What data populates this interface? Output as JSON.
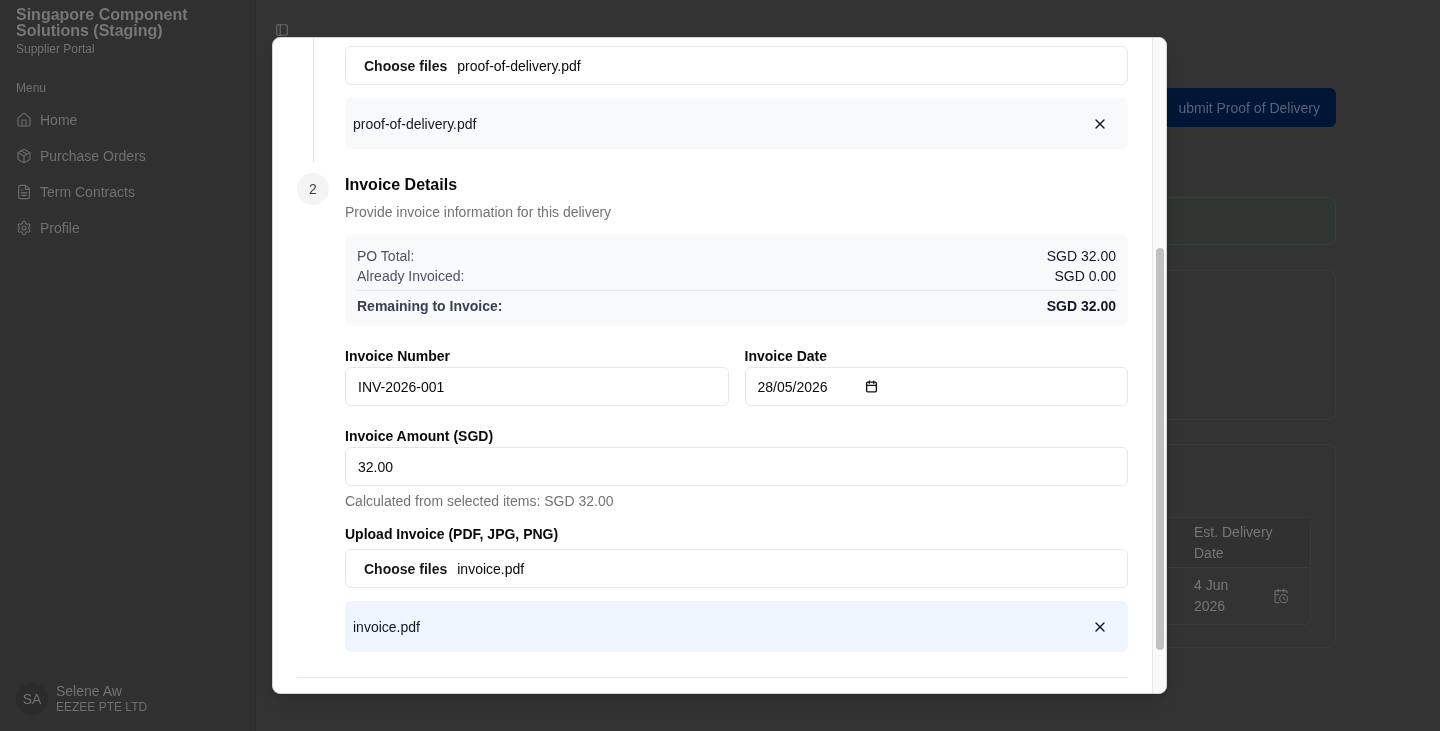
{
  "sidebar": {
    "org_name": "Singapore Component Solutions (Staging)",
    "portal_name": "Supplier Portal",
    "section_heading": "Menu",
    "items": [
      {
        "label": "Home",
        "selected": false
      },
      {
        "label": "Purchase Orders",
        "selected": false
      },
      {
        "label": "Term Contracts",
        "selected": false
      },
      {
        "label": "Profile",
        "selected": false
      }
    ],
    "user": {
      "initials": "SA",
      "name": "Selene Aw",
      "company": "EEZEE PTE LTD"
    }
  },
  "page": {
    "primary_button": "ubmit Proof of Delivery",
    "table": {
      "columns": [
        "Est. Delivery Date"
      ],
      "rows": [
        [
          "4 Jun 2026"
        ]
      ]
    }
  },
  "dialog": {
    "delivery_upload": {
      "button": "Choose files",
      "value": "proof-of-delivery.pdf"
    },
    "delivery_files": [
      {
        "name": "proof-of-delivery.pdf"
      }
    ],
    "step": {
      "number": "2",
      "title": "Invoice Details",
      "description": "Provide invoice information for this delivery"
    },
    "summary": [
      {
        "kind": "line",
        "label": "PO Total:",
        "value": "SGD 32.00"
      },
      {
        "kind": "line",
        "label": "Already Invoiced:",
        "value": "SGD 0.00"
      },
      {
        "kind": "total",
        "label": "Remaining to Invoice:",
        "value": "SGD 32.00"
      }
    ],
    "invoice_number": {
      "label": "Invoice Number",
      "value": "INV-2026-001"
    },
    "invoice_date": {
      "label": "Invoice Date",
      "value": "28/05/2026"
    },
    "invoice_amount": {
      "label": "Invoice Amount (SGD)",
      "value": "32.00",
      "hint": "Calculated from selected items: SGD 32.00"
    },
    "invoice_upload": {
      "label": "Upload Invoice (PDF, JPG, PNG)",
      "button": "Choose files",
      "value": "invoice.pdf"
    },
    "invoice_files": [
      {
        "name": "invoice.pdf"
      }
    ]
  }
}
